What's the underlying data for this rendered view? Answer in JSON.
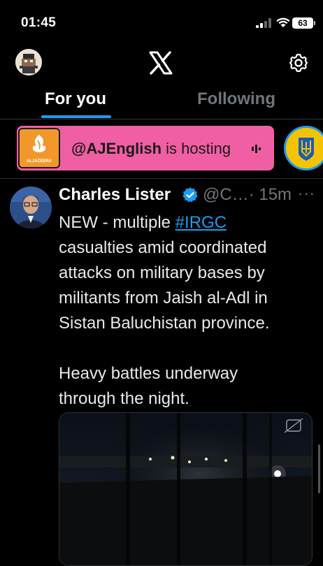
{
  "status_bar": {
    "time": "01:45",
    "battery": "63"
  },
  "header": {
    "logo_icon": "x-logo-icon",
    "settings_icon": "gear-icon"
  },
  "tabs": [
    {
      "label": "For you",
      "active": true
    },
    {
      "label": "Following",
      "active": false
    }
  ],
  "spaces": {
    "host_handle": "@AJEnglish",
    "host_suffix": " is hosting",
    "logo_text": "ALJAZEERA",
    "card_color": "#f05fa3",
    "logo_color": "#f2982b"
  },
  "tweet": {
    "author_name": "Charles Lister",
    "handle": "@C…",
    "time": "· 15m",
    "more": "···",
    "text_prefix": "NEW - multiple ",
    "hashtag": "#IRGC",
    "text_rest": " casualties amid coordinated attacks on military bases by militants from Jaish al-Adl in Sistan Baluchistan province.",
    "paragraph_2": "Heavy battles underway through the night."
  },
  "colors": {
    "accent": "#1d9bf0",
    "background": "#000000",
    "secondary_text": "#71767b"
  }
}
